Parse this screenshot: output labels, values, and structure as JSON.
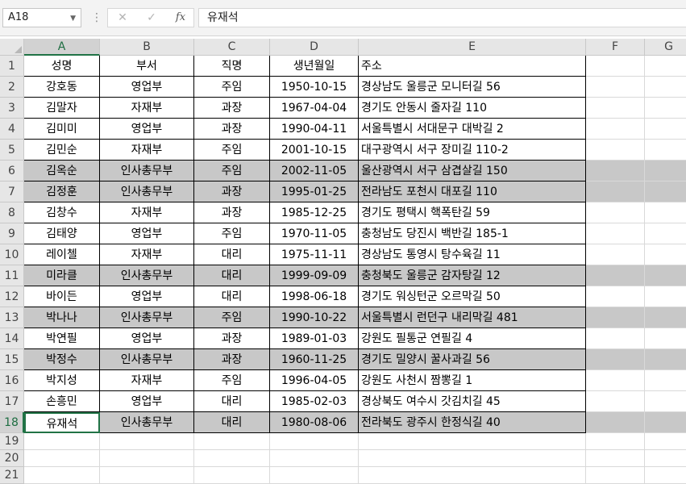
{
  "formula_bar": {
    "name_box": "A18",
    "name_box_dropdown_icon": "chevron-down-icon",
    "cancel_icon": "close-icon",
    "enter_icon": "check-icon",
    "fx_label": "fx",
    "formula": "유재석"
  },
  "columns": [
    "A",
    "B",
    "C",
    "D",
    "E",
    "F",
    "G"
  ],
  "selected_column": "A",
  "selected_row": 18,
  "row_numbers": [
    "1",
    "2",
    "3",
    "4",
    "5",
    "6",
    "7",
    "8",
    "9",
    "10",
    "11",
    "12",
    "13",
    "14",
    "15",
    "16",
    "17",
    "18",
    "19",
    "20",
    "21"
  ],
  "headers": [
    "성명",
    "부서",
    "직명",
    "생년월일",
    "주소"
  ],
  "rows": [
    [
      "강호동",
      "영업부",
      "주임",
      "1950-10-15",
      "경상남도 울릉군 모니터길 56"
    ],
    [
      "김말자",
      "자재부",
      "과장",
      "1967-04-04",
      "경기도 안동시 줄자길 110"
    ],
    [
      "김미미",
      "영업부",
      "과장",
      "1990-04-11",
      "서울특별시 서대문구 대박길 2"
    ],
    [
      "김민순",
      "자재부",
      "주임",
      "2001-10-15",
      "대구광역시 서구 장미길 110-2"
    ],
    [
      "김옥순",
      "인사총무부",
      "주임",
      "2002-11-05",
      "울산광역시 서구 삼겹살길 150"
    ],
    [
      "김정훈",
      "인사총무부",
      "과장",
      "1995-01-25",
      "전라남도 포천시 대포길 110"
    ],
    [
      "김창수",
      "자재부",
      "과장",
      "1985-12-25",
      "경기도 평택시 핵폭탄길 59"
    ],
    [
      "김태양",
      "영업부",
      "주임",
      "1970-11-05",
      "충청남도 당진시 백반길 185-1"
    ],
    [
      "레이첼",
      "자재부",
      "대리",
      "1975-11-11",
      "경상남도 통영시 탕수육길 11"
    ],
    [
      "미라클",
      "인사총무부",
      "대리",
      "1999-09-09",
      "충청북도 울릉군 감자탕길 12"
    ],
    [
      "바이든",
      "영업부",
      "대리",
      "1998-06-18",
      "경기도 워싱턴군 오르막길 50"
    ],
    [
      "박나나",
      "인사총무부",
      "주임",
      "1990-10-22",
      "서울특별시 런던구 내리막길 481"
    ],
    [
      "박연필",
      "영업부",
      "과장",
      "1989-01-03",
      "강원도 필통군 연필길 4"
    ],
    [
      "박정수",
      "인사총무부",
      "과장",
      "1960-11-25",
      "경기도 밀양시 꿀사과길 56"
    ],
    [
      "박지성",
      "자재부",
      "주임",
      "1996-04-05",
      "강원도 사천시 짬뽕길 1"
    ],
    [
      "손흥민",
      "영업부",
      "대리",
      "1985-02-03",
      "경상북도 여수시 갓김치길 45"
    ],
    [
      "유재석",
      "인사총무부",
      "대리",
      "1980-08-06",
      "전라북도 광주시 한정식길 40"
    ]
  ],
  "highlight_color": "#c8c8c8",
  "highlight_department": "인사총무부",
  "accent_color": "#217346"
}
